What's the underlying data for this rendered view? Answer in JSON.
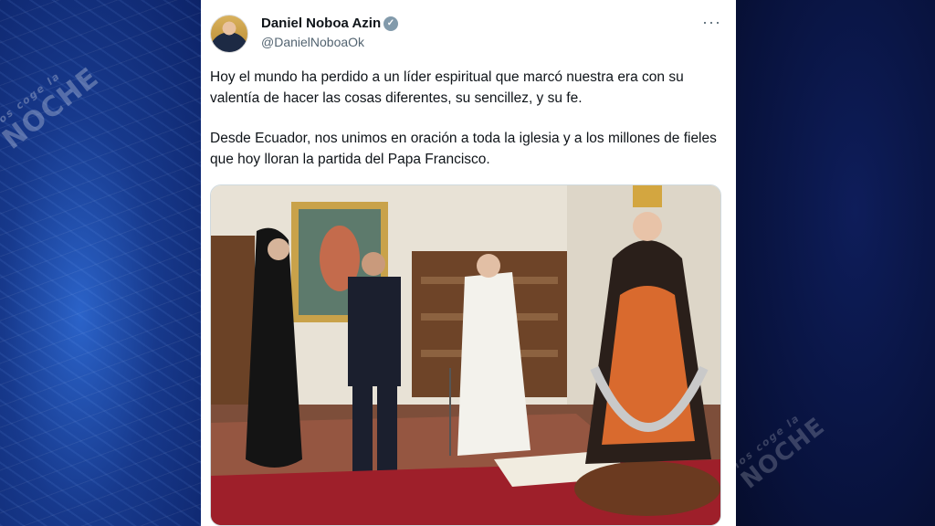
{
  "watermark": {
    "prefix": "nos coge la",
    "brand": "Noche"
  },
  "tweet": {
    "author_name": "Daniel Noboa Azin",
    "handle": "@DanielNoboaOk",
    "verified_icon": "verified-badge-icon",
    "more_icon": "more-options-icon",
    "more_label": "···",
    "paragraphs": [
      "Hoy el mundo ha perdido a un líder espiritual que marcó nuestra era con su valentía de hacer las cosas diferentes, su sencillez, y su fe.",
      "Desde Ecuador, nos unimos en oración a toda la iglesia y a los millones de fieles que hoy lloran la partida del Papa Francisco."
    ]
  },
  "colors": {
    "text": "#0f1419",
    "secondary": "#536471",
    "card_bg": "#ffffff",
    "left_bg": "#1d4aa8",
    "right_bg": "#08123c"
  }
}
